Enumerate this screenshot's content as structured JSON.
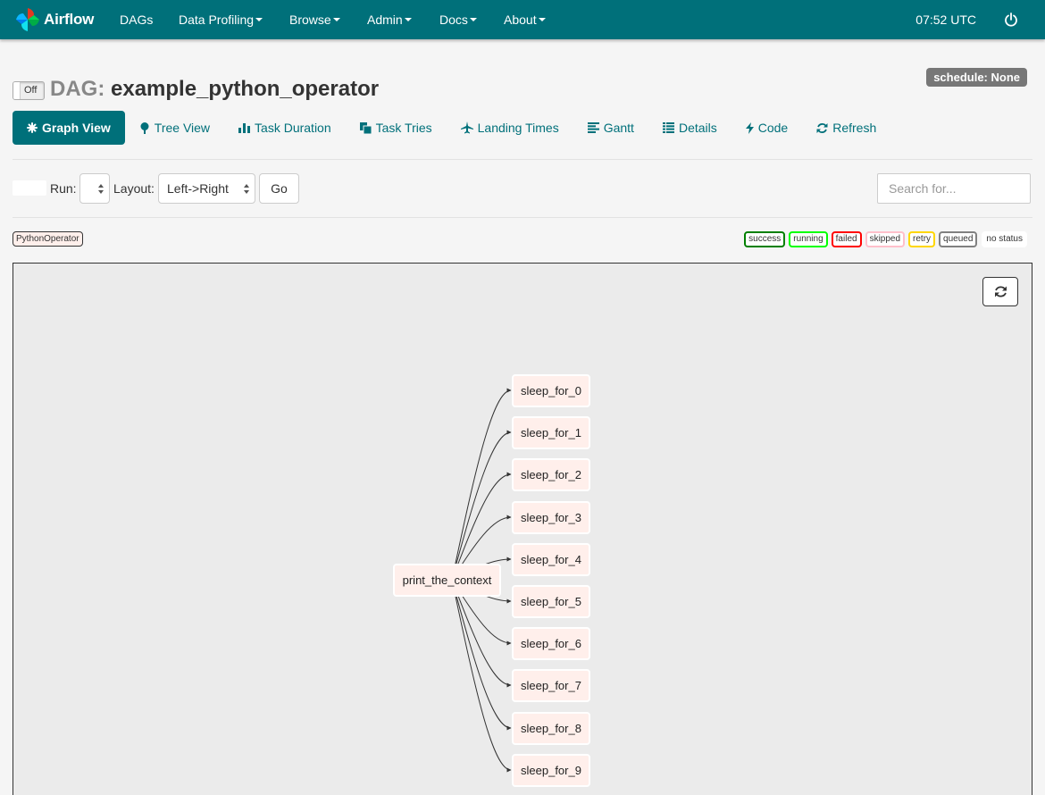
{
  "navbar": {
    "brand": "Airflow",
    "items": [
      {
        "label": "DAGs",
        "dropdown": false
      },
      {
        "label": "Data Profiling",
        "dropdown": true
      },
      {
        "label": "Browse",
        "dropdown": true
      },
      {
        "label": "Admin",
        "dropdown": true
      },
      {
        "label": "Docs",
        "dropdown": true
      },
      {
        "label": "About",
        "dropdown": true
      }
    ],
    "clock": "07:52 UTC",
    "color": "#00707a"
  },
  "header": {
    "toggle_label": "Off",
    "dag_prefix": "DAG:",
    "dag_name": "example_python_operator",
    "schedule": "schedule: None"
  },
  "tabs": [
    {
      "label": "Graph View",
      "icon": "asterisk-icon",
      "active": true
    },
    {
      "label": "Tree View",
      "icon": "tree-icon"
    },
    {
      "label": "Task Duration",
      "icon": "bar-chart-icon"
    },
    {
      "label": "Task Tries",
      "icon": "duplicate-icon"
    },
    {
      "label": "Landing Times",
      "icon": "plane-icon"
    },
    {
      "label": "Gantt",
      "icon": "align-left-icon"
    },
    {
      "label": "Details",
      "icon": "list-icon"
    },
    {
      "label": "Code",
      "icon": "flash-icon"
    },
    {
      "label": "Refresh",
      "icon": "refresh-icon"
    }
  ],
  "controls": {
    "run_label": "Run:",
    "layout_label": "Layout:",
    "layout_value": "Left->Right",
    "go_label": "Go",
    "search_placeholder": "Search for..."
  },
  "operator_badge": "PythonOperator",
  "legend": [
    {
      "label": "success",
      "color": "#008000"
    },
    {
      "label": "running",
      "color": "#00ff00"
    },
    {
      "label": "failed",
      "color": "#ff0000"
    },
    {
      "label": "skipped",
      "color": "#ffc0cb"
    },
    {
      "label": "retry",
      "color": "#ffd700"
    },
    {
      "label": "queued",
      "color": "#808080"
    },
    {
      "label": "no status",
      "color": "#ffffff"
    }
  ],
  "graph": {
    "root": "print_the_context",
    "tasks": [
      "sleep_for_0",
      "sleep_for_1",
      "sleep_for_2",
      "sleep_for_3",
      "sleep_for_4",
      "sleep_for_5",
      "sleep_for_6",
      "sleep_for_7",
      "sleep_for_8",
      "sleep_for_9"
    ]
  }
}
